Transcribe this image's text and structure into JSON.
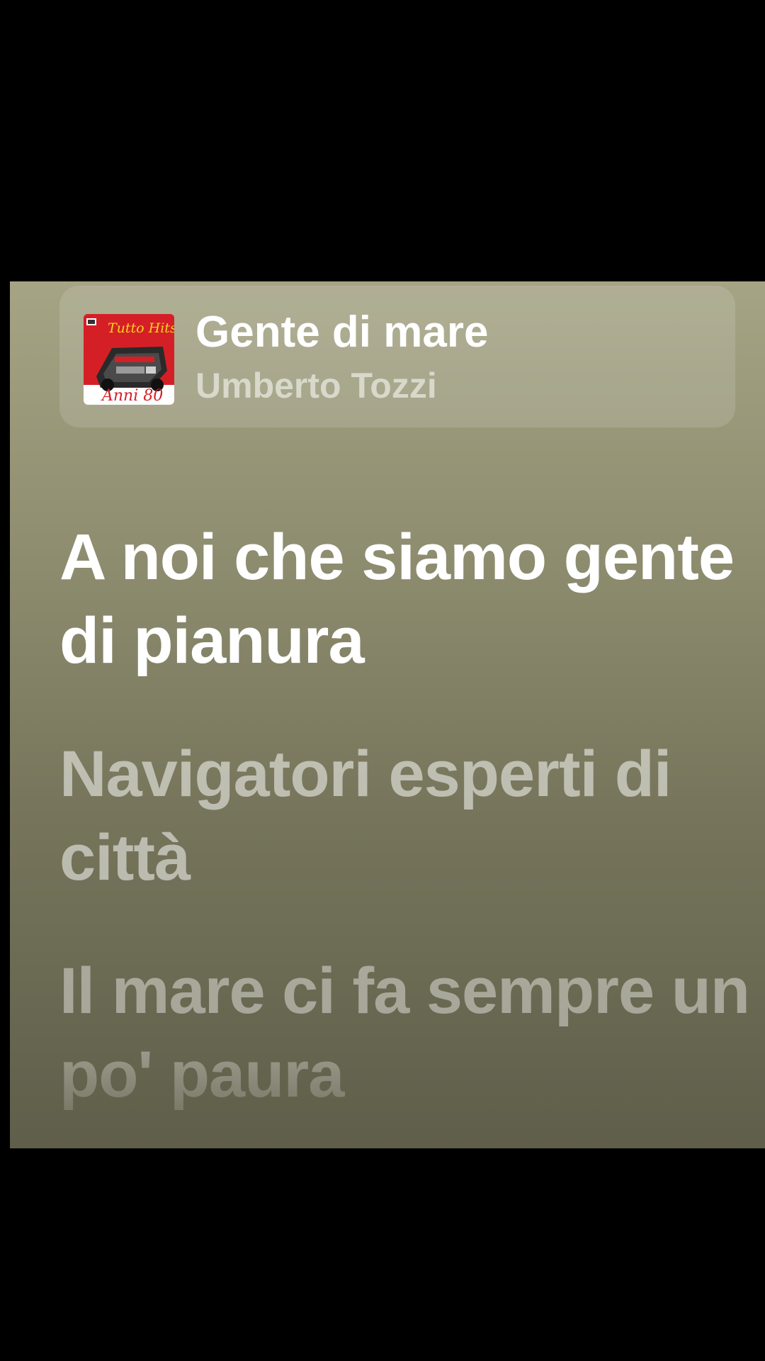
{
  "now_playing": {
    "title": "Gente di mare",
    "artist": "Umberto Tozzi",
    "cover_text_top": "Tutto Hits",
    "cover_text_bottom": "Anni 80",
    "cover_color": "#d51f26"
  },
  "lyrics": {
    "lines": [
      {
        "text": "A noi che siamo gente di pianura",
        "state": "active"
      },
      {
        "text": "Navigatori esperti di città",
        "state": "upcoming"
      },
      {
        "text": "Il mare ci fa sempre un po' paura",
        "state": "upcoming"
      }
    ]
  },
  "colors": {
    "background": "#000000",
    "card_top": "#a5a485",
    "card_bottom": "#5f5e4a",
    "active_lyric": "#ffffff"
  }
}
